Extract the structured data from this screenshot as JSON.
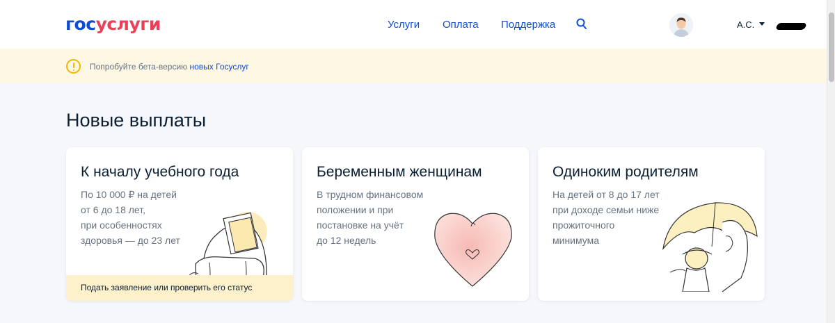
{
  "header": {
    "logo_part1": "гос",
    "logo_part2": "услуги",
    "nav": [
      "Услуги",
      "Оплата",
      "Поддержка"
    ],
    "search_icon": "search-icon",
    "user_name": "А.С."
  },
  "banner": {
    "text": "Попробуйте бета-версию ",
    "link": "новых Госуслуг"
  },
  "section": {
    "title": "Новые выплаты"
  },
  "cards": [
    {
      "title": "К началу учебного года",
      "lines": [
        "По 10 000 ₽ на детей",
        "от 6 до 18 лет,",
        "при особенностях",
        "здоровья — до 23 лет"
      ],
      "footer": "Подать заявление или проверить его статус",
      "illustration": "backpack-illustration"
    },
    {
      "title": "Беременным женщинам",
      "lines": [
        "В трудном финансовом",
        "положении и при",
        "постановке на учёт",
        "до 12 недель"
      ],
      "illustration": "heart-illustration"
    },
    {
      "title": "Одиноким родителям",
      "lines": [
        "На детей от 8 до 17 лет",
        "при доходе семьи ниже",
        "прожиточного",
        "минимума"
      ],
      "illustration": "parent-child-umbrella-illustration"
    }
  ],
  "colors": {
    "brand_blue": "#0d4cd3",
    "brand_red": "#ee3f58",
    "banner_bg": "#fdf7e3",
    "warning": "#f4b400",
    "page_bg": "#f5f7fb"
  }
}
